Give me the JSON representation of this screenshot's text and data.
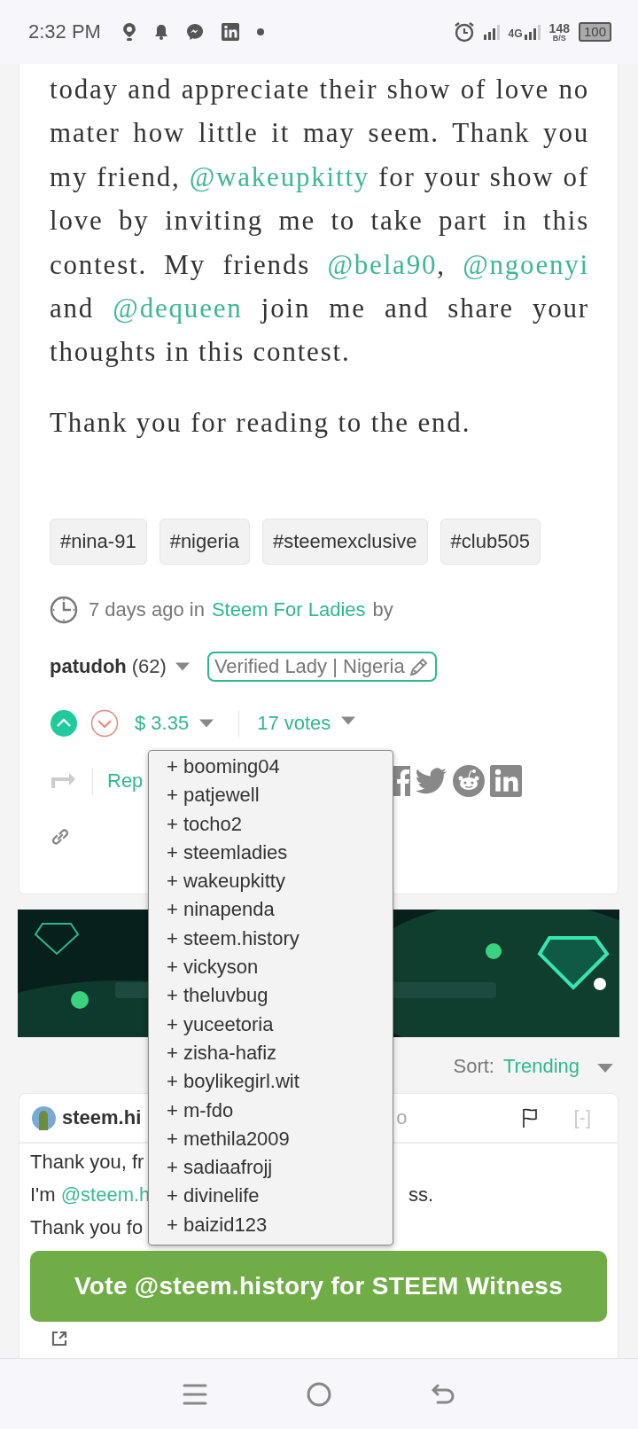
{
  "status_bar": {
    "time": "2:32 PM",
    "network": "4G",
    "speed": "148",
    "speed_unit": "B/S",
    "battery": "100"
  },
  "post": {
    "paragraphs": [
      [
        {
          "kind": "text",
          "text": "today and appreciate their show of love no mater how little it may seem. Thank you my friend, "
        },
        {
          "kind": "mention",
          "text": "@wakeupkitty"
        },
        {
          "kind": "text",
          "text": " for your show of love by inviting me to take part in this contest. My friends "
        },
        {
          "kind": "mention",
          "text": "@bela90"
        },
        {
          "kind": "text",
          "text": ", "
        },
        {
          "kind": "mention",
          "text": "@ngoenyi"
        },
        {
          "kind": "text",
          "text": " and "
        },
        {
          "kind": "mention",
          "text": "@dequeen"
        },
        {
          "kind": "text",
          "text": " join me and share your thoughts in this contest."
        }
      ],
      [
        {
          "kind": "text",
          "text": "Thank you for reading to the end."
        }
      ]
    ],
    "tags": [
      "#nina-91",
      "#nigeria",
      "#steemexclusive",
      "#club505"
    ],
    "meta": {
      "age": "7 days ago in",
      "community": "Steem For Ladies",
      "by": "by"
    },
    "author": {
      "name": "patudoh",
      "reputation": "(62)",
      "badge": "Verified Lady | Nigeria"
    },
    "voting": {
      "upvoted": true,
      "downvoted": false,
      "payout": "$ 3.35",
      "votes": "17 votes"
    },
    "actions": {
      "reply": "Rep"
    },
    "voters_menu": {
      "items": [
        "+ booming04",
        "+ patjewell",
        "+ tocho2",
        "+ steemladies",
        "+ wakeupkitty",
        "+ ninapenda",
        "+ steem.history",
        "+ vickyson",
        "+ theluvbug",
        "+ yuceetoria",
        "+ zisha-hafiz",
        "+ boylikegirl.wit",
        "+ m-fdo",
        "+ methila2009",
        "+ sadiaafrojj",
        "+ divinelife",
        "+ baizid123"
      ]
    }
  },
  "sort": {
    "label": "Sort:",
    "value": "Trending"
  },
  "comment": {
    "author": "steem.hi",
    "time": "o",
    "collapse": "[-]",
    "lines": [
      {
        "segments": [
          {
            "kind": "text",
            "text": "Thank you, fr"
          }
        ]
      },
      {
        "segments": [
          {
            "kind": "text",
            "text": "I'm "
          },
          {
            "kind": "mention",
            "text": "@steem.h"
          }
        ],
        "after": "ss."
      },
      {
        "segments": [
          {
            "kind": "text",
            "text": "Thank you fo"
          }
        ]
      }
    ],
    "button": "Vote @steem.history for STEEM Witness"
  }
}
